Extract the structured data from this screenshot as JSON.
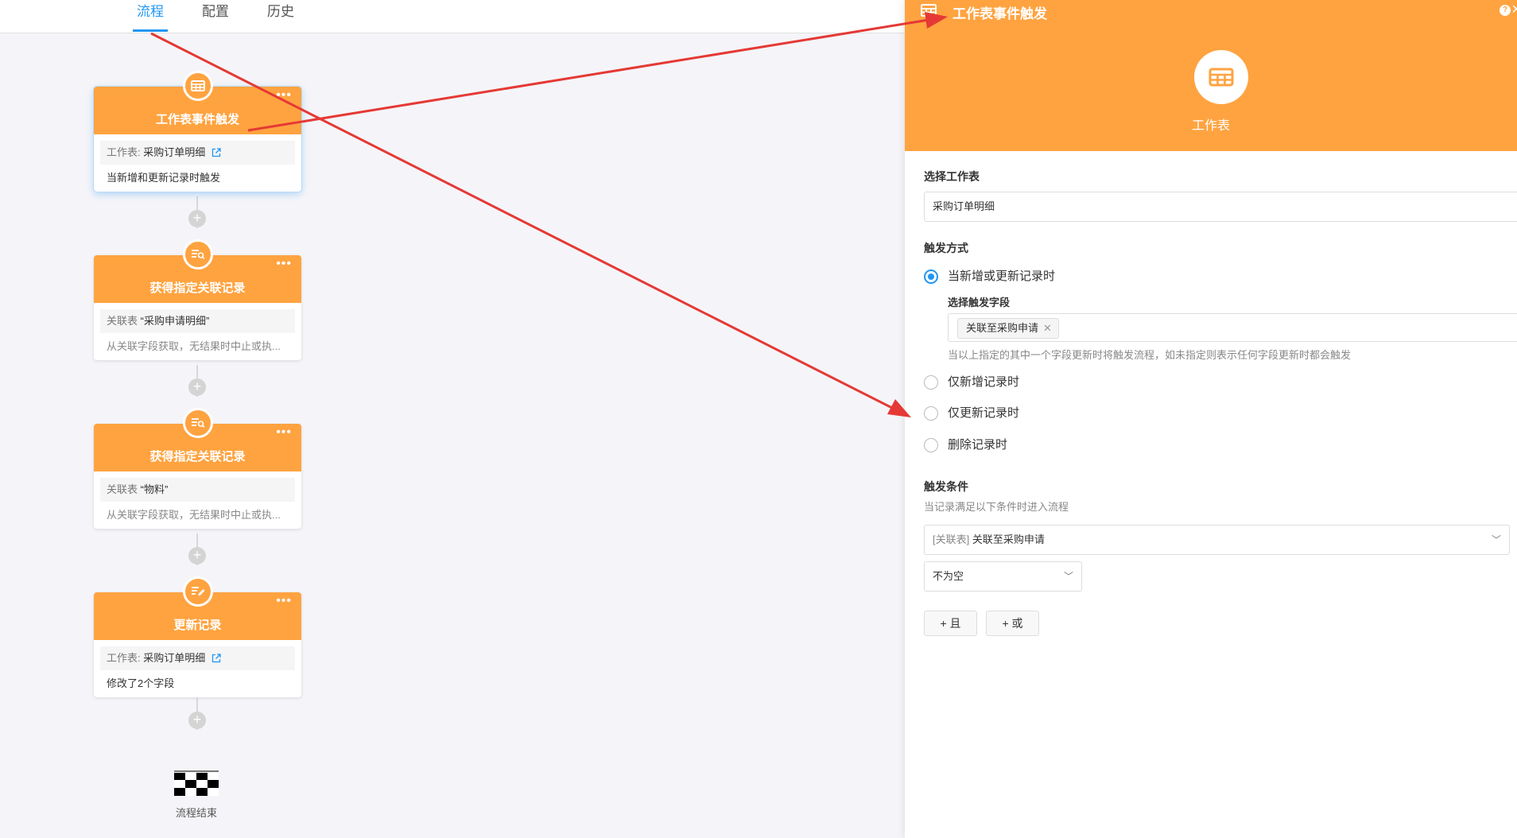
{
  "tabs": [
    {
      "label": "流程"
    },
    {
      "label": "配置"
    },
    {
      "label": "历史"
    }
  ],
  "nodes": [
    {
      "title": "工作表事件触发",
      "row_label": "工作表: ",
      "row_value": "采购订单明细",
      "desc": "当新增和更新记录时触发",
      "icon": "table-icon"
    },
    {
      "title": "获得指定关联记录",
      "row_label": "关联表 ",
      "row_value": "“采购申请明细”",
      "desc": "从关联字段获取，无结果时中止或执...",
      "icon": "search-record-icon"
    },
    {
      "title": "获得指定关联记录",
      "row_label": "关联表 ",
      "row_value": "“物料”",
      "desc": "从关联字段获取，无结果时中止或执...",
      "icon": "search-record-icon"
    },
    {
      "title": "更新记录",
      "row_label": "工作表: ",
      "row_value": "采购订单明细",
      "desc": "修改了2个字段",
      "icon": "edit-record-icon"
    }
  ],
  "end_label": "流程结束",
  "panel": {
    "title": "工作表事件触发",
    "subtitle": "工作表",
    "select_sheet_label": "选择工作表",
    "select_sheet_value": "采购订单明细",
    "trigger_mode_label": "触发方式",
    "trigger_options": [
      {
        "label": "当新增或更新记录时",
        "checked": true
      },
      {
        "label": "仅新增记录时",
        "checked": false
      },
      {
        "label": "仅更新记录时",
        "checked": false
      },
      {
        "label": "删除记录时",
        "checked": false
      }
    ],
    "trigger_field_label": "选择触发字段",
    "trigger_field_tag": "关联至采购申请",
    "trigger_field_hint": "当以上指定的其中一个字段更新时将触发流程，如未指定则表示任何字段更新时都会触发",
    "condition_label": "触发条件",
    "condition_hint": "当记录满足以下条件时进入流程",
    "condition_field_prefix": "[关联表]",
    "condition_field_value": "关联至采购申请",
    "condition_operator": "不为空",
    "and_button": "+ 且",
    "or_button": "+ 或"
  },
  "colors": {
    "accent": "#ffa340",
    "primary": "#2196f3",
    "arrow": "#e53935"
  }
}
